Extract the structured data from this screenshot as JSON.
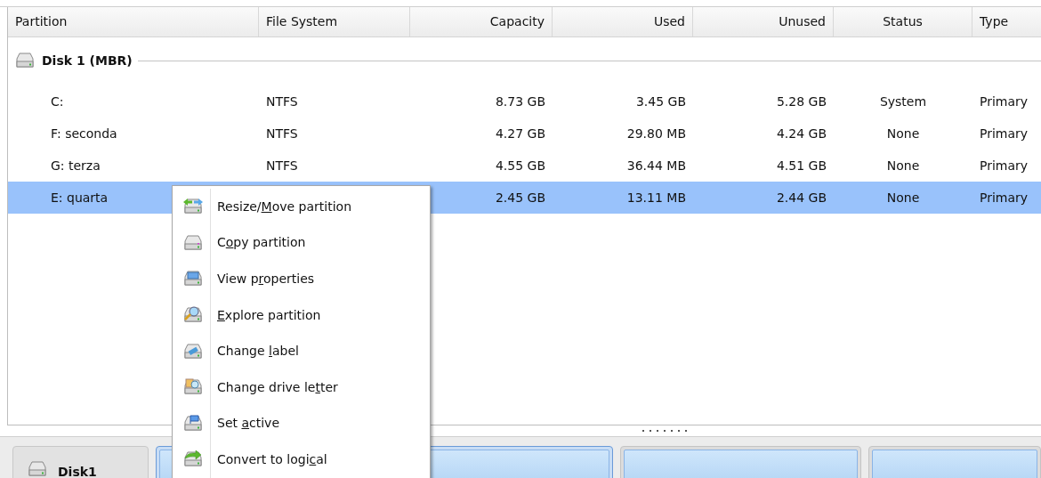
{
  "table": {
    "columns": [
      {
        "label": "Partition"
      },
      {
        "label": "File System"
      },
      {
        "label": "Capacity"
      },
      {
        "label": "Used"
      },
      {
        "label": "Unused"
      },
      {
        "label": "Status"
      },
      {
        "label": "Type"
      }
    ],
    "disk": {
      "label": "Disk 1 (MBR)"
    },
    "rows": [
      {
        "cells": [
          "C:",
          "NTFS",
          "8.73 GB",
          "3.45 GB",
          "5.28 GB",
          "System",
          "Primary"
        ],
        "selected": false
      },
      {
        "cells": [
          "F: seconda",
          "NTFS",
          "4.27 GB",
          "29.80 MB",
          "4.24 GB",
          "None",
          "Primary"
        ],
        "selected": false
      },
      {
        "cells": [
          "G: terza",
          "NTFS",
          "4.55 GB",
          "36.44 MB",
          "4.51 GB",
          "None",
          "Primary"
        ],
        "selected": false
      },
      {
        "cells": [
          "E: quarta",
          null,
          "2.45 GB",
          "13.11 MB",
          "2.44 GB",
          "None",
          "Primary"
        ],
        "selected": true
      }
    ]
  },
  "disk_map": {
    "disk_label": "Disk1",
    "blocks": [
      {
        "selected": true
      },
      {
        "selected": false
      },
      {
        "selected": false
      }
    ]
  },
  "context_menu": {
    "items": [
      {
        "kind": "resize",
        "pre": "Resize/",
        "key": "M",
        "post": "ove partition"
      },
      {
        "kind": "copy",
        "pre": "C",
        "key": "o",
        "post": "py partition"
      },
      {
        "kind": "properties",
        "pre": "View p",
        "key": "r",
        "post": "operties"
      },
      {
        "kind": "explore",
        "key": "E",
        "post": "xplore partition"
      },
      {
        "kind": "label",
        "pre": "Change ",
        "key": "l",
        "post": "abel"
      },
      {
        "kind": "letter",
        "pre": "Change drive le",
        "key": "t",
        "post": "ter"
      },
      {
        "kind": "active",
        "pre": "Set ",
        "key": "a",
        "post": "ctive"
      },
      {
        "kind": "convert",
        "pre": "Convert to logi",
        "key": "c",
        "post": "al"
      }
    ]
  }
}
